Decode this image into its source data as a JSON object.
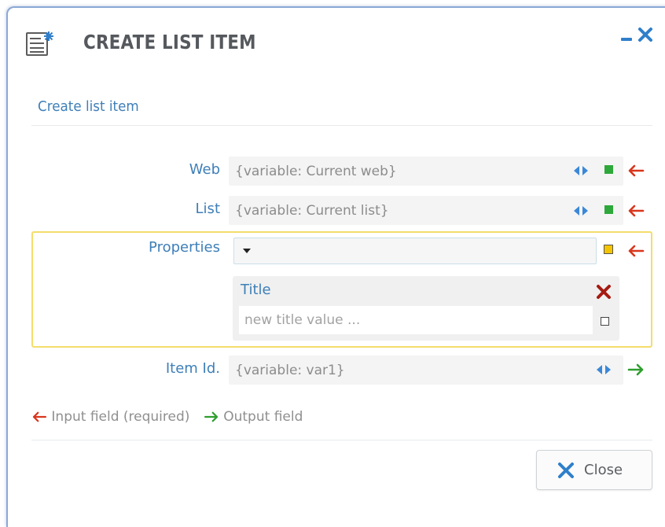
{
  "dialog": {
    "title": "CREATE LIST ITEM",
    "subtitle": "Create list item",
    "icons": {
      "header": "list-sparkle-icon",
      "minimize": "minimize-icon",
      "close": "close-icon"
    }
  },
  "fields": {
    "web": {
      "label": "Web",
      "value": "{variable: Current web}"
    },
    "list": {
      "label": "List",
      "value": "{variable: Current list}"
    },
    "properties": {
      "label": "Properties",
      "selected": ""
    },
    "title_property": {
      "label": "Title",
      "placeholder": "new title value ..."
    },
    "item_id": {
      "label": "Item Id.",
      "value": "{variable: var1}"
    }
  },
  "legend": {
    "input_label": "Input field (required)",
    "output_label": "Output field"
  },
  "footer": {
    "close_label": "Close"
  },
  "colors": {
    "accent_blue": "#3e7fb8",
    "input_arrow": "#d9361c",
    "output_arrow": "#2e9e2e",
    "status_green": "#2ea83a",
    "status_yellow": "#f4c400",
    "frame_highlight": "#f4dd6b",
    "remove_red": "#a51b12"
  }
}
